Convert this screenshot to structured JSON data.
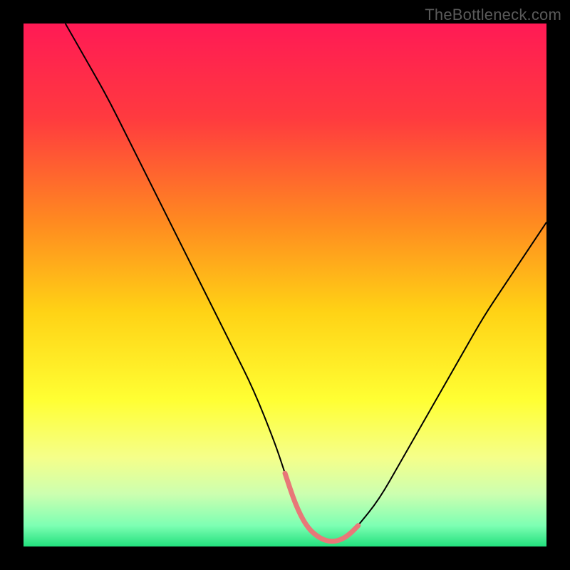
{
  "watermark": "TheBottleneck.com",
  "chart_data": {
    "type": "line",
    "title": "",
    "xlabel": "",
    "ylabel": "",
    "xlim": [
      0,
      100
    ],
    "ylim": [
      0,
      100
    ],
    "background_gradient": {
      "stops": [
        {
          "offset": 0,
          "color": "#ff1a55"
        },
        {
          "offset": 18,
          "color": "#ff3a3f"
        },
        {
          "offset": 38,
          "color": "#ff8a20"
        },
        {
          "offset": 55,
          "color": "#ffd215"
        },
        {
          "offset": 72,
          "color": "#ffff33"
        },
        {
          "offset": 83,
          "color": "#f5ff8a"
        },
        {
          "offset": 90,
          "color": "#ccffb0"
        },
        {
          "offset": 96,
          "color": "#7dffb3"
        },
        {
          "offset": 100,
          "color": "#22e07d"
        }
      ]
    },
    "series": [
      {
        "name": "curve",
        "stroke": "#000000",
        "stroke_width": 2,
        "x": [
          8,
          12,
          16,
          20,
          24,
          28,
          32,
          36,
          40,
          44,
          48,
          50,
          52,
          54,
          56,
          58,
          60,
          62,
          64,
          68,
          72,
          76,
          80,
          84,
          88,
          92,
          96,
          100
        ],
        "y": [
          100,
          93,
          86,
          78,
          70,
          62,
          54,
          46,
          38,
          30,
          20,
          14,
          8,
          4,
          2,
          1,
          1,
          2,
          4,
          9,
          16,
          23,
          30,
          37,
          44,
          50,
          56,
          62
        ]
      },
      {
        "name": "bottom-marker",
        "stroke": "#e87878",
        "stroke_width": 7,
        "linecap": "round",
        "x": [
          50,
          52,
          54,
          56,
          58,
          60,
          62,
          64
        ],
        "y": [
          14,
          8,
          4,
          2,
          1,
          1,
          2,
          4
        ]
      }
    ]
  }
}
